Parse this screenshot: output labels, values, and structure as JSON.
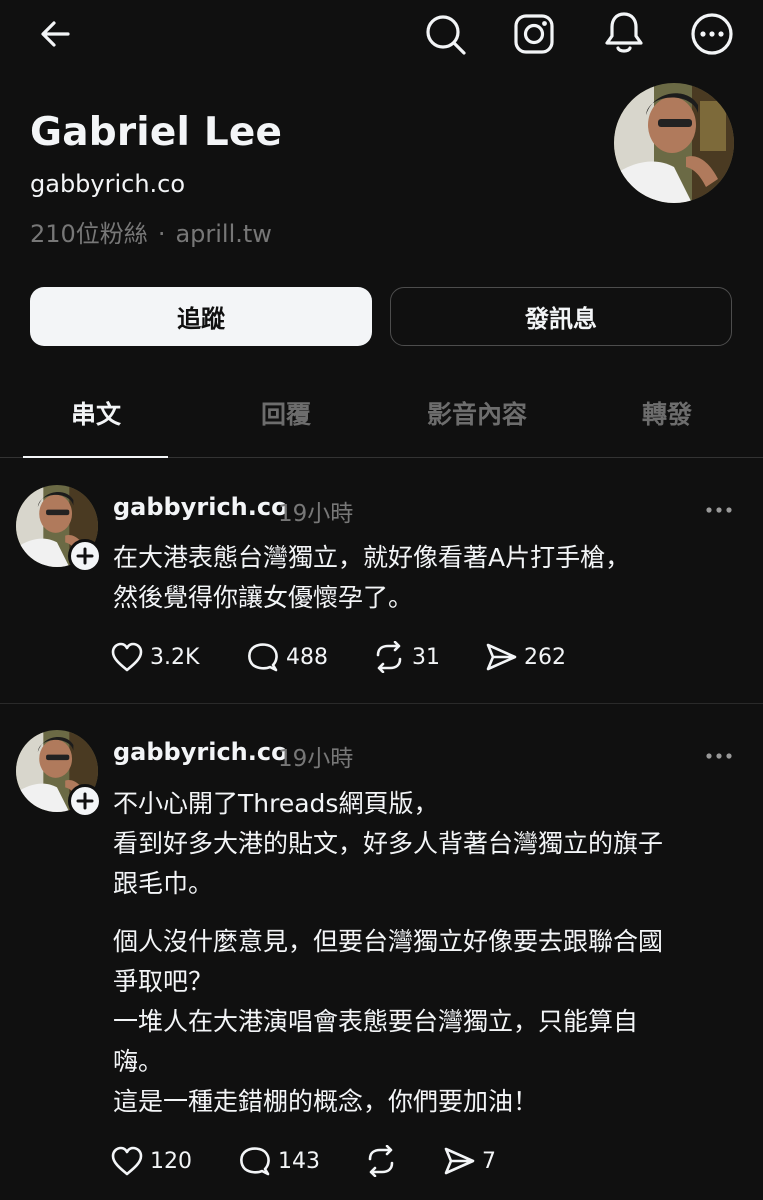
{
  "profile": {
    "name": "Gabriel Lee",
    "handle": "gabbyrich.co",
    "followers": "210位粉絲",
    "separator": "·",
    "link": "aprill.tw"
  },
  "buttons": {
    "follow": "追蹤",
    "message": "發訊息"
  },
  "tabs": [
    {
      "label": "串文",
      "active": true
    },
    {
      "label": "回覆",
      "active": false
    },
    {
      "label": "影音內容",
      "active": false
    },
    {
      "label": "轉發",
      "active": false
    }
  ],
  "posts": [
    {
      "user": "gabbyrich.co",
      "time": "19小時",
      "lines": [
        "在大港表態台灣獨立，就好像看著A片打手槍，",
        "然後覺得你讓女優懷孕了。"
      ],
      "likes": "3.2K",
      "comments": "488",
      "reposts": "31",
      "shares": "262"
    },
    {
      "user": "gabbyrich.co",
      "time": "19小時",
      "paragraph1": [
        "不小心開了Threads網頁版，",
        "看到好多大港的貼文，好多人背著台灣獨立的旗子",
        "跟毛巾。"
      ],
      "paragraph2": [
        "個人沒什麼意見，但要台灣獨立好像要去跟聯合國",
        "爭取吧？",
        "一堆人在大港演唱會表態要台灣獨立，只能算自",
        "嗨。",
        "這是一種走錯棚的概念，你們要加油！"
      ],
      "likes": "120",
      "comments": "143",
      "reposts": "",
      "shares": "7"
    }
  ],
  "icons": [
    "back-arrow-icon",
    "search-icon",
    "instagram-icon",
    "notification-bell-icon",
    "more-options-icon"
  ],
  "colors": {
    "background": "#101010",
    "text": "#f3f5f7",
    "muted": "#777777"
  }
}
